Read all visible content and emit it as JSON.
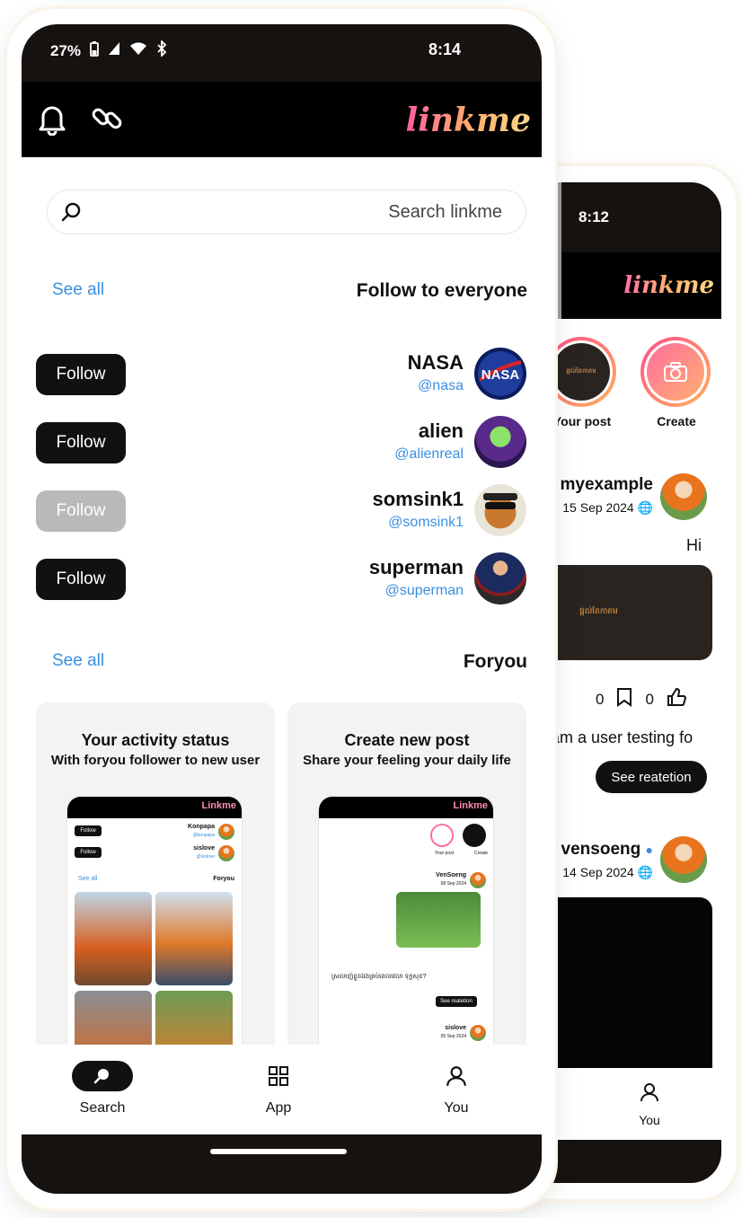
{
  "front": {
    "status": {
      "time": "8:14",
      "battery": "27%"
    },
    "logo": "linkme",
    "search": {
      "placeholder": "Search linkme"
    },
    "follow_section": {
      "title": "Follow to everyone",
      "see_all": "See all"
    },
    "users": [
      {
        "name": "NASA",
        "handle": "@nasa",
        "button": "Follow",
        "state": "default"
      },
      {
        "name": "alien",
        "handle": "@alienreal",
        "button": "Follow",
        "state": "default"
      },
      {
        "name": "somsink1",
        "handle": "@somsink1",
        "button": "Follow",
        "state": "pending"
      },
      {
        "name": "superman",
        "handle": "@superman",
        "button": "Follow",
        "state": "default"
      }
    ],
    "foryou_section": {
      "title": "Foryou",
      "see_all": "See all"
    },
    "cards": [
      {
        "title": "Create new post",
        "subtitle": "Share your feeling your daily life",
        "mini": {
          "logo": "Linkme",
          "create": "Create",
          "your_post": "Your post",
          "user": "VenSoeng",
          "date": "08 Sep 2024",
          "caption": "ស្រលាញ់ខ្លួនឯងគ្រប់ពេលវេលា ទុក្ខសុខ?",
          "button": "See reatetion",
          "user2": "sislove",
          "date2": "05 Sep 2024"
        }
      },
      {
        "title": "Your activity status",
        "subtitle": "With foryou follower to new user",
        "mini": {
          "logo": "Linkme",
          "user": "Konpapa",
          "handle": "@konpapa",
          "user2": "sislove",
          "handle2": "@sislove",
          "follow": "Follow",
          "foryou": "Foryou",
          "see_all": "See all"
        }
      }
    ],
    "nav": [
      {
        "label": "You",
        "icon": "person-icon"
      },
      {
        "label": "App",
        "icon": "grid-icon"
      },
      {
        "label": "Search",
        "icon": "search-icon",
        "active": true
      }
    ]
  },
  "back": {
    "status": {
      "time": "8:12"
    },
    "logo": "linkme",
    "stories": [
      {
        "label": "Create"
      },
      {
        "label": "Your post",
        "thumb_text": "ផ្ដល់តែកាតម"
      }
    ],
    "posts": [
      {
        "name": "myexample",
        "date": "15 Sep 2024",
        "text": "Hi",
        "card_text": "ផ្ដល់តែកាតម",
        "likes": "0",
        "saves": "0",
        "caption": "I am a user testing fo",
        "button": "See reatetion"
      },
      {
        "name": "vensoeng",
        "date": "14 Sep 2024"
      }
    ],
    "nav": {
      "label": "You"
    }
  },
  "colors": {
    "accent": "#3a8fe0",
    "dark": "#161210",
    "pending": "#b9b9b9"
  }
}
